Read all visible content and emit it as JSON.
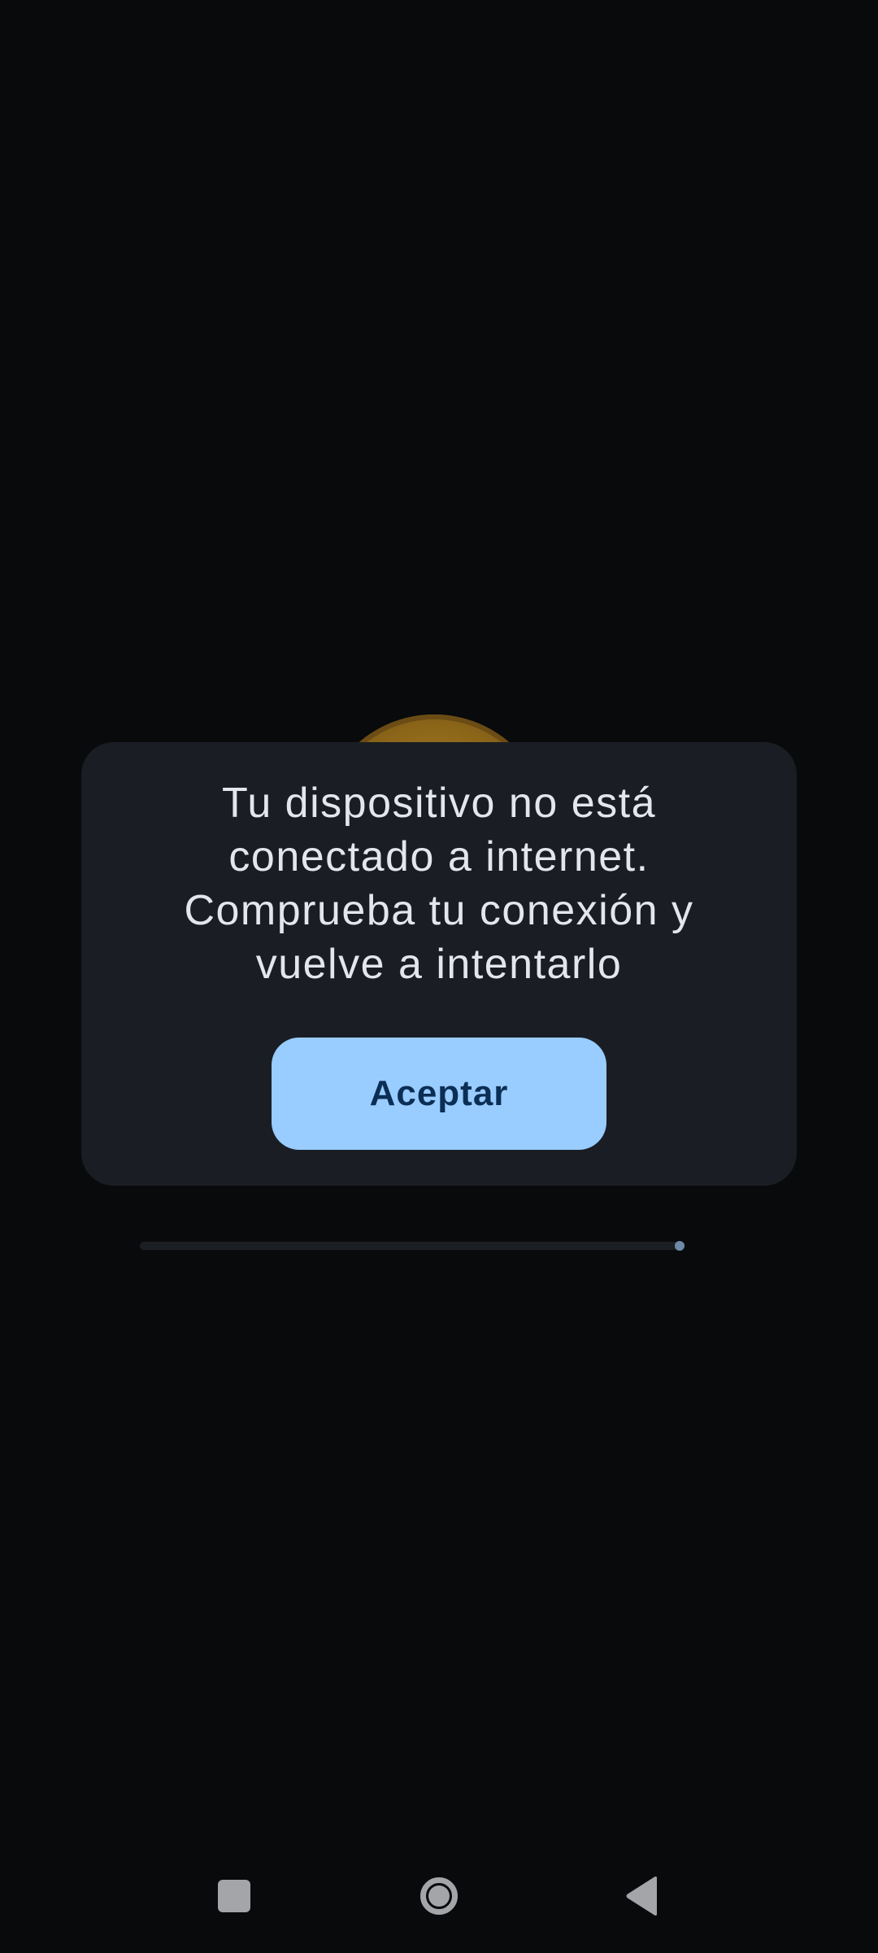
{
  "dialog": {
    "message": "Tu dispositivo no está conectado a internet. Comprueba tu conexión y vuelve a intentarlo",
    "accept_label": "Aceptar"
  },
  "progress": {
    "value": 1.0
  },
  "navbar": {
    "recents_icon": "square-icon",
    "home_icon": "circle-icon",
    "back_icon": "triangle-back-icon"
  },
  "colors": {
    "background": "#090a0c",
    "dialog_bg": "#1a1e24",
    "button_bg": "#99ccff",
    "button_text": "#0b2e55"
  }
}
